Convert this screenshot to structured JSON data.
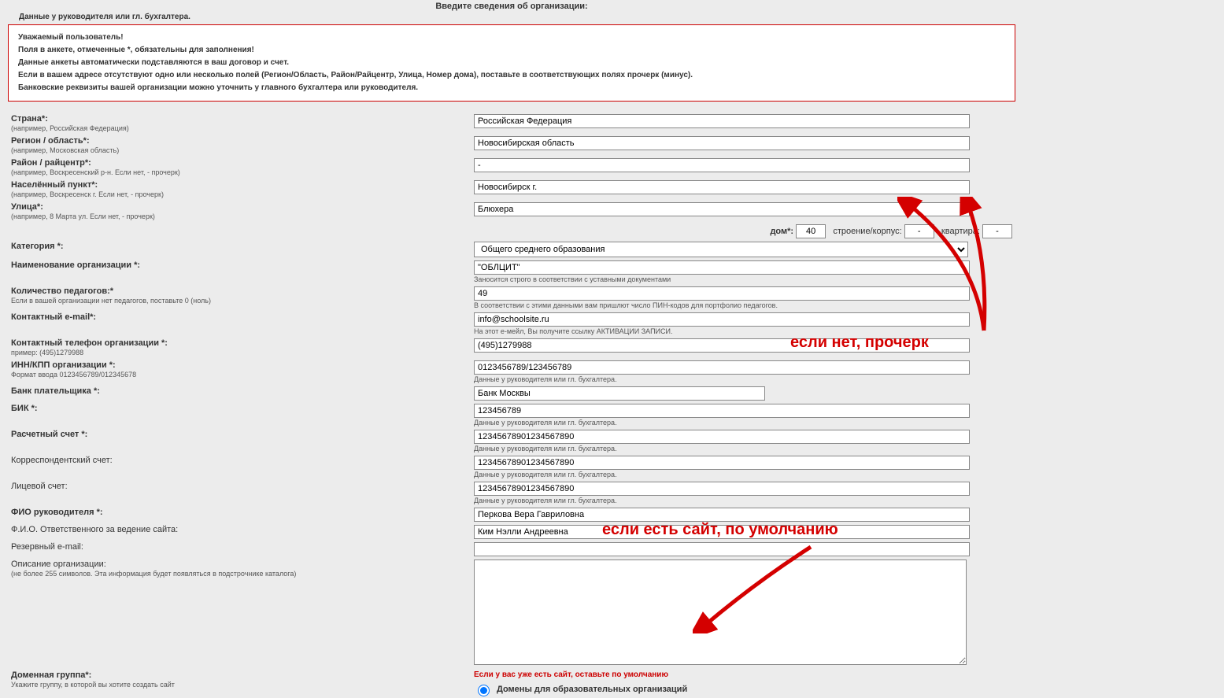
{
  "header": "Введите сведения об организации:",
  "topnote": "Данные у руководителя или гл. бухгалтера.",
  "notice": [
    "Уважаемый пользователь!",
    "Поля в анкете, отмеченные *, обязательны для заполнения!",
    "Данные анкеты автоматически подставляются в ваш договор и счет.",
    "Если в вашем адресе отсутствуют одно или несколько полей (Регион/Область, Район/Райцентр, Улица, Номер дома), поставьте в соответствующих полях прочерк (минус).",
    "Банковские реквизиты вашей организации можно уточнить у главного бухгалтера или руководителя."
  ],
  "labels": {
    "country": "Страна*:",
    "country_hint": "(например, Российская Федерация)",
    "region": "Регион / область*:",
    "region_hint": "(например, Московская область)",
    "district": "Район / райцентр*:",
    "district_hint": "(например, Воскресенский р-н. Если нет, - прочерк)",
    "city": "Населённый пункт*:",
    "city_hint": "(например, Воскресенск г. Если нет, - прочерк)",
    "street": "Улица*:",
    "street_hint": "(например, 8 Марта ул. Если нет, - прочерк)",
    "house": "дом*:",
    "building": "строение/корпус:",
    "flat": "квартира:",
    "category": "Категория *:",
    "orgname": "Наименование организации *:",
    "orgname_hint": "Заносится строго в соответствии с уставными документами",
    "teachers": "Количество педагогов:*",
    "teachers_hint": "Если в вашей организации нет педагогов, поставьте 0 (ноль)",
    "teachers_sub": "В соответствии с этими данными вам пришлют число ПИН-кодов для портфолио педагогов.",
    "email": "Контактный e-mail*:",
    "email_sub": "На этот е-мейл, Вы получите ссылку АКТИВАЦИИ ЗАПИСИ.",
    "phone": "Контактный телефон организации *:",
    "phone_hint": "пример: (495)1279988",
    "inn": "ИНН/КПП организации *:",
    "inn_hint": "Формат ввода 0123456789/012345678",
    "bank": "Банк плательщика *:",
    "bik": "БИК *:",
    "rs": "Расчетный счет *:",
    "ks": "Корреспондентский счет:",
    "ls": "Лицевой счет:",
    "fio_head": "ФИО руководителя *:",
    "fio_resp": "Ф.И.О. Ответственного за ведение сайта:",
    "reserve": "Резервный e-mail:",
    "desc": "Описание организации:",
    "desc_hint": "(не более 255 символов. Эта информация будет появляться в подстрочнике каталога)",
    "domain": "Доменная группа*:",
    "domain_hint": "Укажите группу, в которой вы хотите создать сайт",
    "domain_warn": "Если у вас уже есть сайт, оставьте по умолчанию",
    "domain_radio": "Домены для образовательных организаций",
    "sub_ruk": "Данные у руководителя или гл. бухгалтера."
  },
  "values": {
    "country": "Российская Федерация",
    "region": "Новосибирская область",
    "district": "-",
    "city": "Новосибирск г.",
    "street": "Блюхера",
    "house": "40",
    "building": "-",
    "flat": "-",
    "category": "Общего среднего образования",
    "orgname": "\"ОБЛЦИТ\"",
    "teachers": "49",
    "email": "info@schoolsite.ru",
    "phone": "(495)1279988",
    "inn": "0123456789/123456789",
    "bank": "Банк Москвы",
    "bik": "123456789",
    "rs": "12345678901234567890",
    "ks": "12345678901234567890",
    "ls": "12345678901234567890",
    "fio_head": "Перкова Вера Гавриловна",
    "fio_resp": "Ким Нэлли Андреевна",
    "reserve": "",
    "desc": ""
  },
  "annotations": {
    "anno1": "если нет, прочерк",
    "anno2": "если есть сайт, по умолчанию"
  }
}
